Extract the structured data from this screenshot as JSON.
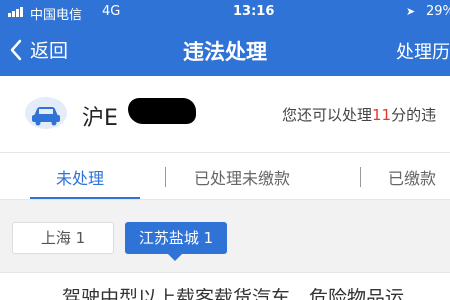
{
  "status_bar": {
    "carrier": "中国电信",
    "network": "4G",
    "time": "13:16",
    "battery": "29%"
  },
  "nav": {
    "back_label": "返回",
    "title": "违法处理",
    "right_label": "处理历"
  },
  "vehicle": {
    "plate_prefix": "沪E",
    "remaining_prefix": "您还可以处理",
    "remaining_points": "11",
    "remaining_suffix": "分的违"
  },
  "tabs": [
    {
      "label": "未处理",
      "active": true
    },
    {
      "label": "已处理未缴款",
      "active": false
    },
    {
      "label": "已缴款",
      "active": false
    }
  ],
  "regions": [
    {
      "label": "上海 1",
      "active": false
    },
    {
      "label": "江苏盐城 1",
      "active": true
    }
  ],
  "violation": {
    "description": "驾驶中型以上载客载货汽车、危险物品运"
  },
  "colors": {
    "primary": "#2f73d6",
    "highlight": "#e53a2a"
  }
}
